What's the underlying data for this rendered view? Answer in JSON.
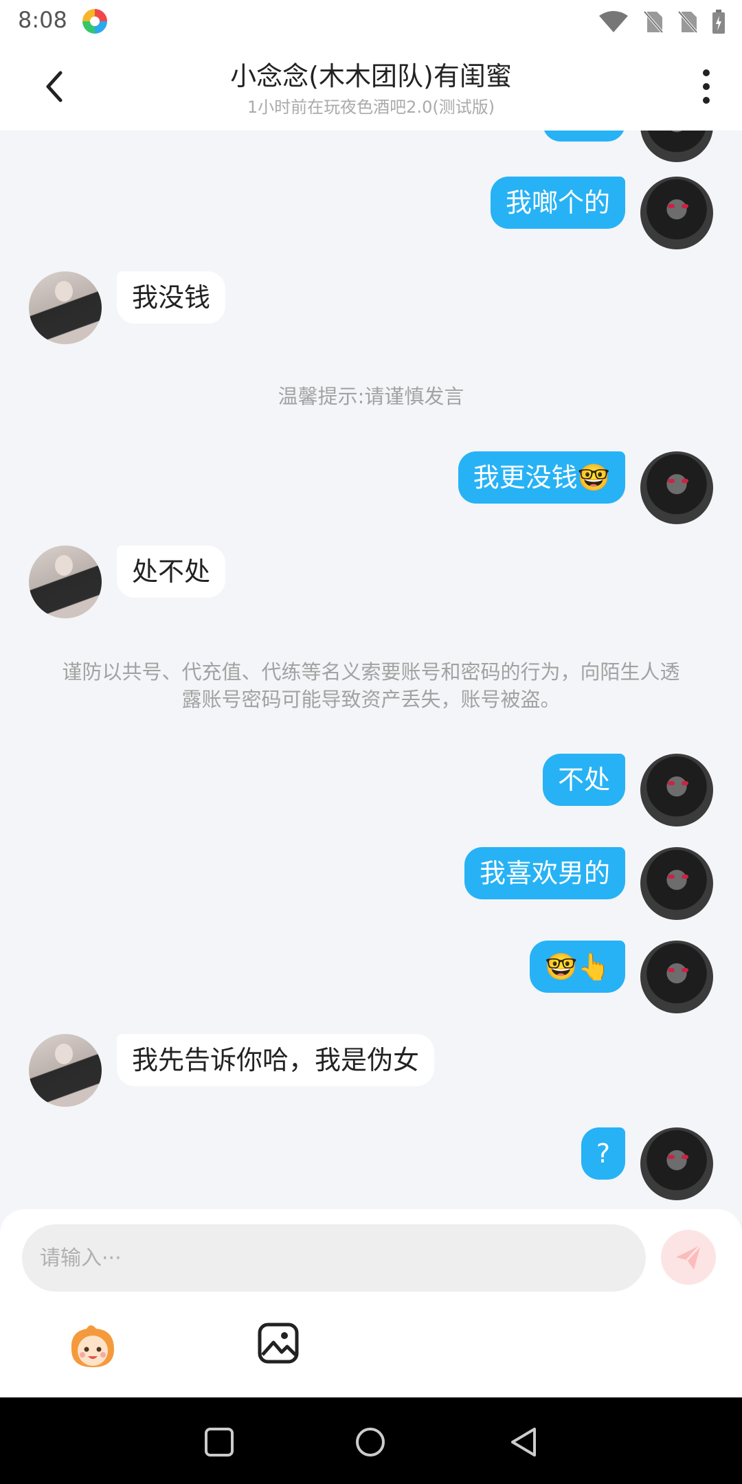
{
  "status_bar": {
    "time": "8:08",
    "icons": [
      "wifi-icon",
      "no-sim-icon",
      "no-sim-icon",
      "battery-icon"
    ]
  },
  "header": {
    "title": "小念念(木木团队)有闺蜜",
    "subtitle": "1小时前在玩夜色酒吧2.0(测试版)"
  },
  "messages": [
    {
      "sender": "self",
      "text": "我啷个的"
    },
    {
      "sender": "other",
      "text": "我没钱"
    },
    {
      "sender": "system",
      "text": "温馨提示:请谨慎发言"
    },
    {
      "sender": "self",
      "text": "我更没钱🤓"
    },
    {
      "sender": "other",
      "text": "处不处"
    },
    {
      "sender": "system",
      "text": "谨防以共号、代充值、代练等名义索要账号和密码的行为，向陌生人透露账号密码可能导致资产丢失，账号被盗。"
    },
    {
      "sender": "self",
      "text": "不处"
    },
    {
      "sender": "self",
      "text": "我喜欢男的"
    },
    {
      "sender": "self",
      "text": "🤓👆"
    },
    {
      "sender": "other",
      "text": "我先告诉你哈，我是伪女"
    },
    {
      "sender": "self",
      "text": "?"
    }
  ],
  "composer": {
    "placeholder": "请输入···",
    "send_color": "#fde4e4"
  },
  "colors": {
    "self_bubble": "#27b2f5",
    "other_bubble": "#ffffff",
    "background": "#f3f5f8"
  }
}
